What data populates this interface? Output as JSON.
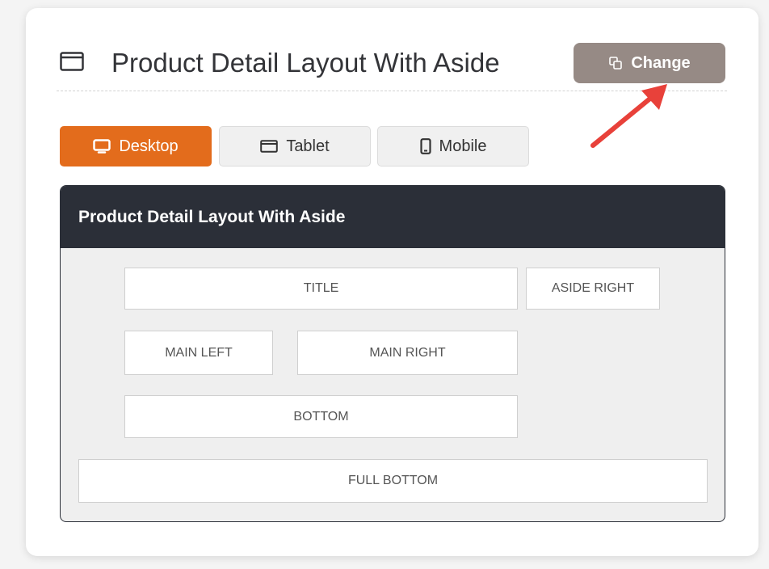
{
  "header": {
    "title": "Product Detail Layout With Aside",
    "title_icon": "window-icon",
    "change_button": {
      "label": "Change",
      "icon": "swap-icon"
    }
  },
  "device_tabs": [
    {
      "label": "Desktop",
      "icon": "desktop-icon",
      "active": true
    },
    {
      "label": "Tablet",
      "icon": "tablet-icon",
      "active": false
    },
    {
      "label": "Mobile",
      "icon": "mobile-icon",
      "active": false
    }
  ],
  "layout_preview": {
    "title": "Product Detail Layout With Aside",
    "regions": {
      "title": "TITLE",
      "aside_right": "ASIDE RIGHT",
      "main_left": "MAIN LEFT",
      "main_right": "MAIN RIGHT",
      "bottom": "BOTTOM",
      "full_bottom": "FULL BOTTOM"
    }
  },
  "colors": {
    "accent": "#e36c1c",
    "change_button": "#968a85",
    "dark_header": "#2b2f38",
    "arrow": "#e8413a"
  }
}
